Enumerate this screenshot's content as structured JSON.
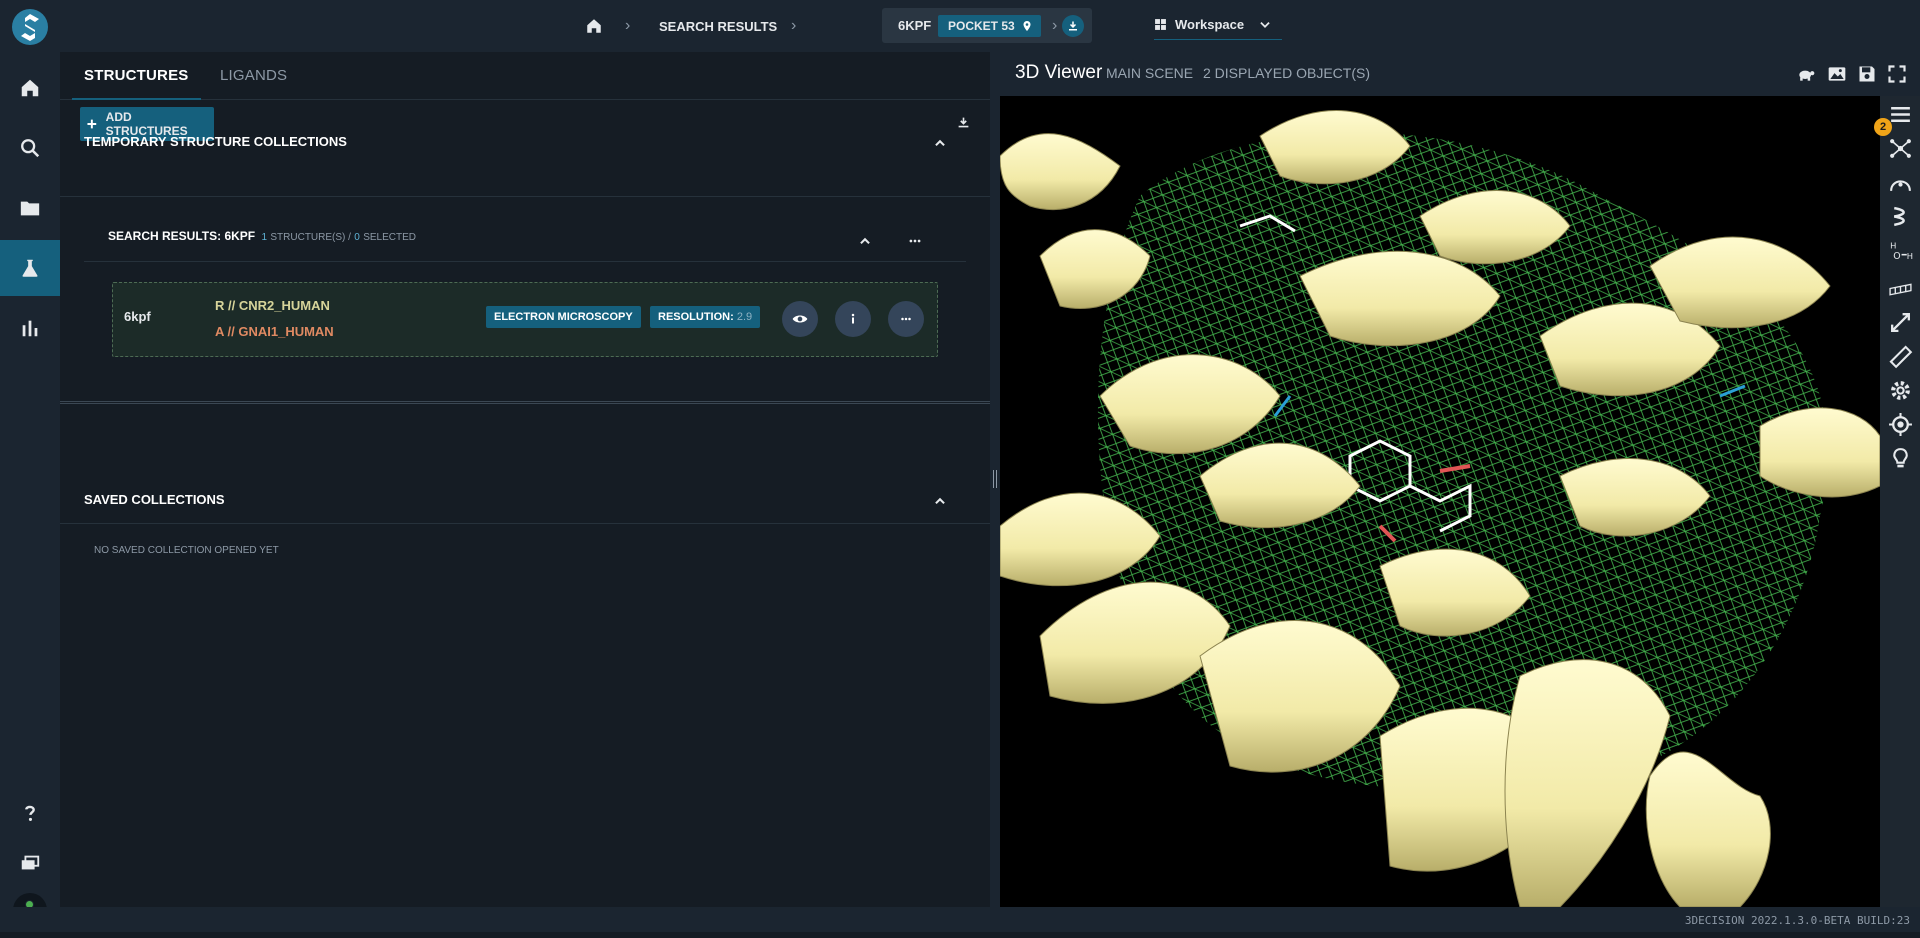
{
  "nav": {
    "items": [
      {
        "icon": "home-icon"
      },
      {
        "icon": "search-icon"
      },
      {
        "icon": "folder-icon"
      },
      {
        "icon": "flask-icon",
        "active": true
      },
      {
        "icon": "bar-chart-icon"
      }
    ],
    "bottom": [
      {
        "icon": "help-icon"
      },
      {
        "icon": "windows-icon"
      },
      {
        "icon": "user-icon"
      }
    ]
  },
  "topbar": {
    "search_results": "SEARCH RESULTS",
    "pdb_code": "6KPF",
    "pocket": "POCKET 53",
    "workspace": "Workspace"
  },
  "tabs": {
    "structures": "STRUCTURES",
    "ligands": "LIGANDS"
  },
  "actions": {
    "add_structures": "ADD STRUCTURES"
  },
  "temp_collections": {
    "title": "TEMPORARY STRUCTURE COLLECTIONS",
    "search_results": {
      "title": "SEARCH RESULTS: 6KPF",
      "structure_count": "1",
      "structure_suffix": "STRUCTURE(S) /",
      "selected_count": "0",
      "selected_suffix": "SELECTED"
    },
    "structure": {
      "pdb_id": "6kpf",
      "chain_r": "R // CNR2_HUMAN",
      "chain_a": "A // GNAI1_HUMAN",
      "method": "ELECTRON MICROSCOPY",
      "resolution_label": "RESOLUTION:",
      "resolution_value": "2.9"
    }
  },
  "saved_collections": {
    "title": "SAVED COLLECTIONS",
    "empty_text": "NO SAVED COLLECTION OPENED YET"
  },
  "viewer": {
    "title": "3D Viewer",
    "scene": "MAIN SCENE",
    "objects": "2 DISPLAYED OBJECT(S)",
    "badge_count": "2"
  },
  "status": {
    "build": "3DECISION 2022.1.3.0-BETA BUILD:23"
  },
  "colors": {
    "accent": "#15607d",
    "ribbon": "#f5f0b4",
    "mesh": "#4fd15a",
    "badge": "#f0a418"
  }
}
